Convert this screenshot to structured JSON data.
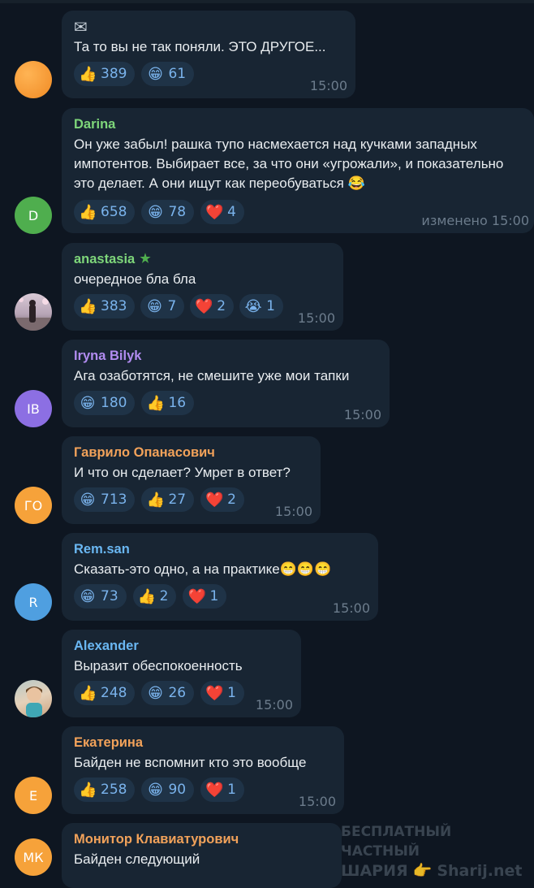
{
  "messages": [
    {
      "sender": "",
      "text": "Та то вы не так поняли. ЭТО ДРУГОЕ...",
      "avatar_text": "",
      "time": "15:00",
      "reactions": [
        {
          "emoji": "👍",
          "count": "389"
        },
        {
          "emoji": "😁",
          "count": "61"
        }
      ]
    },
    {
      "sender": "Darina",
      "text": "Он уже забыл! рашка тупо насмехается над кучками западных импотентов. Выбирает все, за что они «угрожали», и показательно это делает. А они ищут как переобуваться 😂",
      "avatar_text": "D",
      "time": "изменено 15:00",
      "reactions": [
        {
          "emoji": "👍",
          "count": "658"
        },
        {
          "emoji": "😁",
          "count": "78"
        },
        {
          "emoji": "❤️",
          "count": "4"
        }
      ]
    },
    {
      "sender": "anastasia",
      "text": "очередное бла бла",
      "avatar_text": "",
      "time": "15:00",
      "reactions": [
        {
          "emoji": "👍",
          "count": "383"
        },
        {
          "emoji": "😁",
          "count": "7"
        },
        {
          "emoji": "❤️",
          "count": "2"
        },
        {
          "emoji": "😭",
          "count": "1"
        }
      ]
    },
    {
      "sender": "Iryna Bilyk",
      "text": "Ага озаботятся, не смешите уже мои тапки",
      "avatar_text": "IB",
      "time": "15:00",
      "reactions": [
        {
          "emoji": "😁",
          "count": "180"
        },
        {
          "emoji": "👍",
          "count": "16"
        }
      ]
    },
    {
      "sender": "Гаврило Опанасович",
      "text": "И что он сделает? Умрет в ответ?",
      "avatar_text": "ГО",
      "time": "15:00",
      "reactions": [
        {
          "emoji": "😁",
          "count": "713"
        },
        {
          "emoji": "👍",
          "count": "27"
        },
        {
          "emoji": "❤️",
          "count": "2"
        }
      ]
    },
    {
      "sender": "Rem.san",
      "text": "Сказать-это одно, а на практике😁😁😁",
      "avatar_text": "R",
      "time": "15:00",
      "reactions": [
        {
          "emoji": "😁",
          "count": "73"
        },
        {
          "emoji": "👍",
          "count": "2"
        },
        {
          "emoji": "❤️",
          "count": "1"
        }
      ]
    },
    {
      "sender": "Alexander",
      "text": "Выразит обеспокоенность",
      "avatar_text": "",
      "time": "15:00",
      "reactions": [
        {
          "emoji": "👍",
          "count": "248"
        },
        {
          "emoji": "😁",
          "count": "26"
        },
        {
          "emoji": "❤️",
          "count": "1"
        }
      ]
    },
    {
      "sender": "Екатерина",
      "text": "Байден не вспомнит кто это вообще",
      "avatar_text": "E",
      "time": "15:00",
      "reactions": [
        {
          "emoji": "👍",
          "count": "258"
        },
        {
          "emoji": "😁",
          "count": "90"
        },
        {
          "emoji": "❤️",
          "count": "1"
        }
      ]
    },
    {
      "sender": "Монитор Клавиатурович",
      "text": "Байден следующий",
      "avatar_text": "МК",
      "time": "",
      "reactions": []
    }
  ],
  "watermark": {
    "line1": "БЕСПЛАТНЫЙ ЧАСТНЫЙ",
    "line2_left": "ШАРИЯ",
    "line2_right": "Sharij.net"
  },
  "colors": {
    "background": "#0e1621",
    "bubble": "#182533",
    "reaction_bg": "#1f3347",
    "reaction_text": "#7ab3ec",
    "time": "#6c7c8c"
  }
}
